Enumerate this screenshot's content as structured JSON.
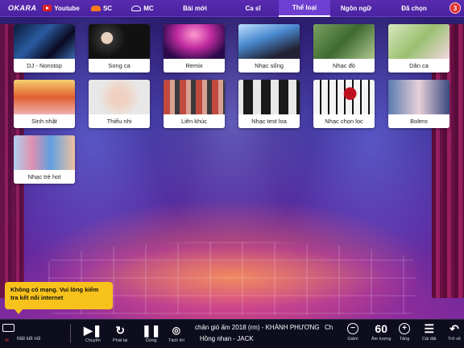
{
  "app": {
    "logo": "OKARA"
  },
  "nav": {
    "items": [
      {
        "label": "Youtube",
        "icon": "youtube-icon"
      },
      {
        "label": "SC",
        "icon": "soundcloud-icon"
      },
      {
        "label": "MC",
        "icon": "cloud-icon"
      },
      {
        "label": "Bài mới"
      },
      {
        "label": "Ca sĩ"
      },
      {
        "label": "Thể loại",
        "active": true
      },
      {
        "label": "Ngôn ngữ"
      },
      {
        "label": "Đã chọn"
      }
    ],
    "selected_count": "3"
  },
  "genres": [
    {
      "label": "DJ - Nonstop"
    },
    {
      "label": "Song ca"
    },
    {
      "label": "Remix"
    },
    {
      "label": "Nhạc sống"
    },
    {
      "label": "Nhạc đỏ"
    },
    {
      "label": "Dân ca"
    },
    {
      "label": "Sinh nhật"
    },
    {
      "label": "Thiếu nhi"
    },
    {
      "label": "Liên khúc"
    },
    {
      "label": "Nhạc test loa"
    },
    {
      "label": "Nhạc chọn lọc"
    },
    {
      "label": "Bolero"
    },
    {
      "label": "Nhạc trẻ hot"
    }
  ],
  "toast": {
    "text": "Không có mạng. Vui lòng kiểm tra kết nối internet"
  },
  "player": {
    "network_status": "Mất kết nối",
    "next": "Chuyển",
    "replay": "Phát lại",
    "pause": "Dừng",
    "separate": "Tách lời",
    "now_playing": "chân gió ấm 2018 (rm) - KHÁNH PHƯƠNG",
    "now_playing_tail": "Ch",
    "up_next": "Hồng nhan - JACK",
    "volume_down": "Giảm",
    "volume": "60",
    "volume_label": "Âm lượng",
    "volume_up": "Tăng",
    "settings": "Cài đặt",
    "back": "Trở về"
  }
}
